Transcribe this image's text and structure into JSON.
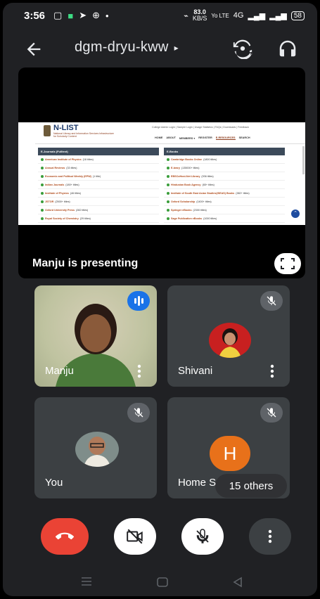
{
  "status_bar": {
    "time": "3:56",
    "net_speed_value": "83.0",
    "net_speed_unit": "KB/S",
    "volte": "Yo LTE",
    "network": "4G",
    "battery": "58"
  },
  "app_bar": {
    "meeting_code": "dgm-dryu-kww",
    "caret": "▸"
  },
  "shared_screen": {
    "brand": "N-LIST",
    "brand_sub": "National Library and Information Services Infrastructure for Scholarly Content",
    "top_links": "College Admin Login | Sample Login | Usage Statistics | FAQs | Downloads | Feedback",
    "nav": [
      "HOME",
      "ABOUT",
      "MEMBERS ▾",
      "REGISTER",
      "E-RESOURCES",
      "SEARCH"
    ],
    "nav_active": "E-RESOURCES",
    "left_header": "E-Journals (Fulltext)",
    "left_rows": [
      {
        "name": "American Institute of Physics",
        "count": "(18 titles)"
      },
      {
        "name": "Annual Reviews",
        "count": "(33 titles)"
      },
      {
        "name": "Economic and Political Weekly (EPW)",
        "count": "(1 title)"
      },
      {
        "name": "Indian Journals",
        "count": "(180+ titles)"
      },
      {
        "name": "Institute of Physics",
        "count": "(46 titles)"
      },
      {
        "name": "JSTOR",
        "count": "(2500+ titles)"
      },
      {
        "name": "Oxford University Press",
        "count": "(282 titles)"
      },
      {
        "name": "Royal Society of Chemistry",
        "count": "(29 titles)"
      }
    ],
    "right_header": "E-Books",
    "right_rows": [
      {
        "name": "Cambridge Books Online",
        "count": "(1800 titles)"
      },
      {
        "name": "E-brary",
        "count": "(135000+ titles)"
      },
      {
        "name": "EBSCoHost-Net Library",
        "count": "(936 titles)"
      },
      {
        "name": "Hindustan Book Agency",
        "count": "(65+ titles)"
      },
      {
        "name": "Institute of South East Asian Studies(ISEAS) Books",
        "count": "(382+ titles)"
      },
      {
        "name": "Oxford Scholarship",
        "count": "(1400+ titles)"
      },
      {
        "name": "Springer eBooks",
        "count": "(2300 titles)"
      },
      {
        "name": "Sage Publication eBooks",
        "count": "(1000 titles)"
      }
    ]
  },
  "presenter_label": "Manju is presenting",
  "participants": [
    {
      "name": "Manju"
    },
    {
      "name": "Shivani"
    },
    {
      "name": "You"
    },
    {
      "name": "Home S",
      "initial": "H"
    }
  ],
  "others_chip": "15 others",
  "colors": {
    "end_call": "#ea4335",
    "speaking": "#1a73e8",
    "avatar_h": "#e8711a"
  }
}
